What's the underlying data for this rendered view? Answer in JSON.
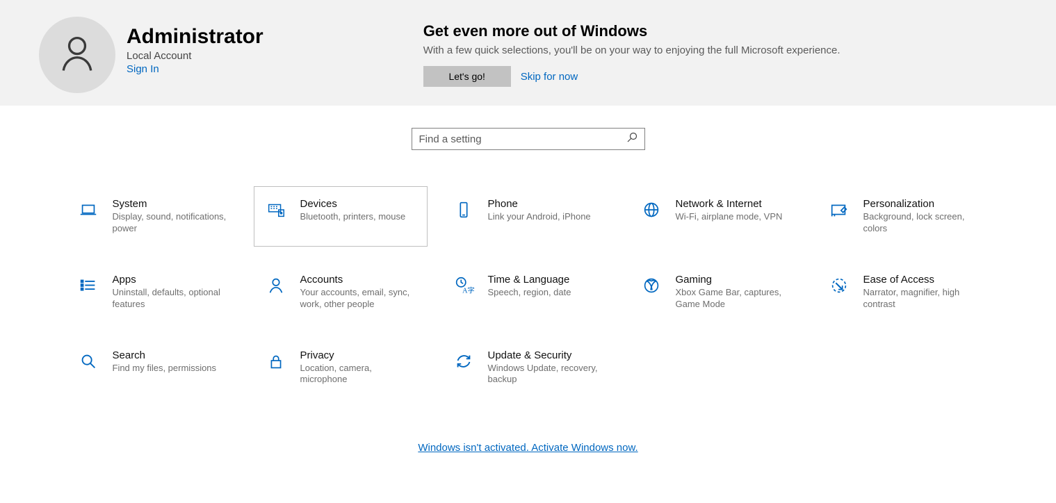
{
  "user": {
    "name": "Administrator",
    "account_type": "Local Account",
    "signin_label": "Sign In"
  },
  "promo": {
    "title": "Get even more out of Windows",
    "subtitle": "With a few quick selections, you'll be on your way to enjoying the full Microsoft experience.",
    "button_label": "Let's go!",
    "skip_label": "Skip for now"
  },
  "search": {
    "placeholder": "Find a setting"
  },
  "tiles": [
    {
      "title": "System",
      "sub": "Display, sound, notifications, power"
    },
    {
      "title": "Devices",
      "sub": "Bluetooth, printers, mouse"
    },
    {
      "title": "Phone",
      "sub": "Link your Android, iPhone"
    },
    {
      "title": "Network & Internet",
      "sub": "Wi-Fi, airplane mode, VPN"
    },
    {
      "title": "Personalization",
      "sub": "Background, lock screen, colors"
    },
    {
      "title": "Apps",
      "sub": "Uninstall, defaults, optional features"
    },
    {
      "title": "Accounts",
      "sub": "Your accounts, email, sync, work, other people"
    },
    {
      "title": "Time & Language",
      "sub": "Speech, region, date"
    },
    {
      "title": "Gaming",
      "sub": "Xbox Game Bar, captures, Game Mode"
    },
    {
      "title": "Ease of Access",
      "sub": "Narrator, magnifier, high contrast"
    },
    {
      "title": "Search",
      "sub": "Find my files, permissions"
    },
    {
      "title": "Privacy",
      "sub": "Location, camera, microphone"
    },
    {
      "title": "Update & Security",
      "sub": "Windows Update, recovery, backup"
    }
  ],
  "footer": {
    "activate_label": "Windows isn't activated. Activate Windows now."
  }
}
